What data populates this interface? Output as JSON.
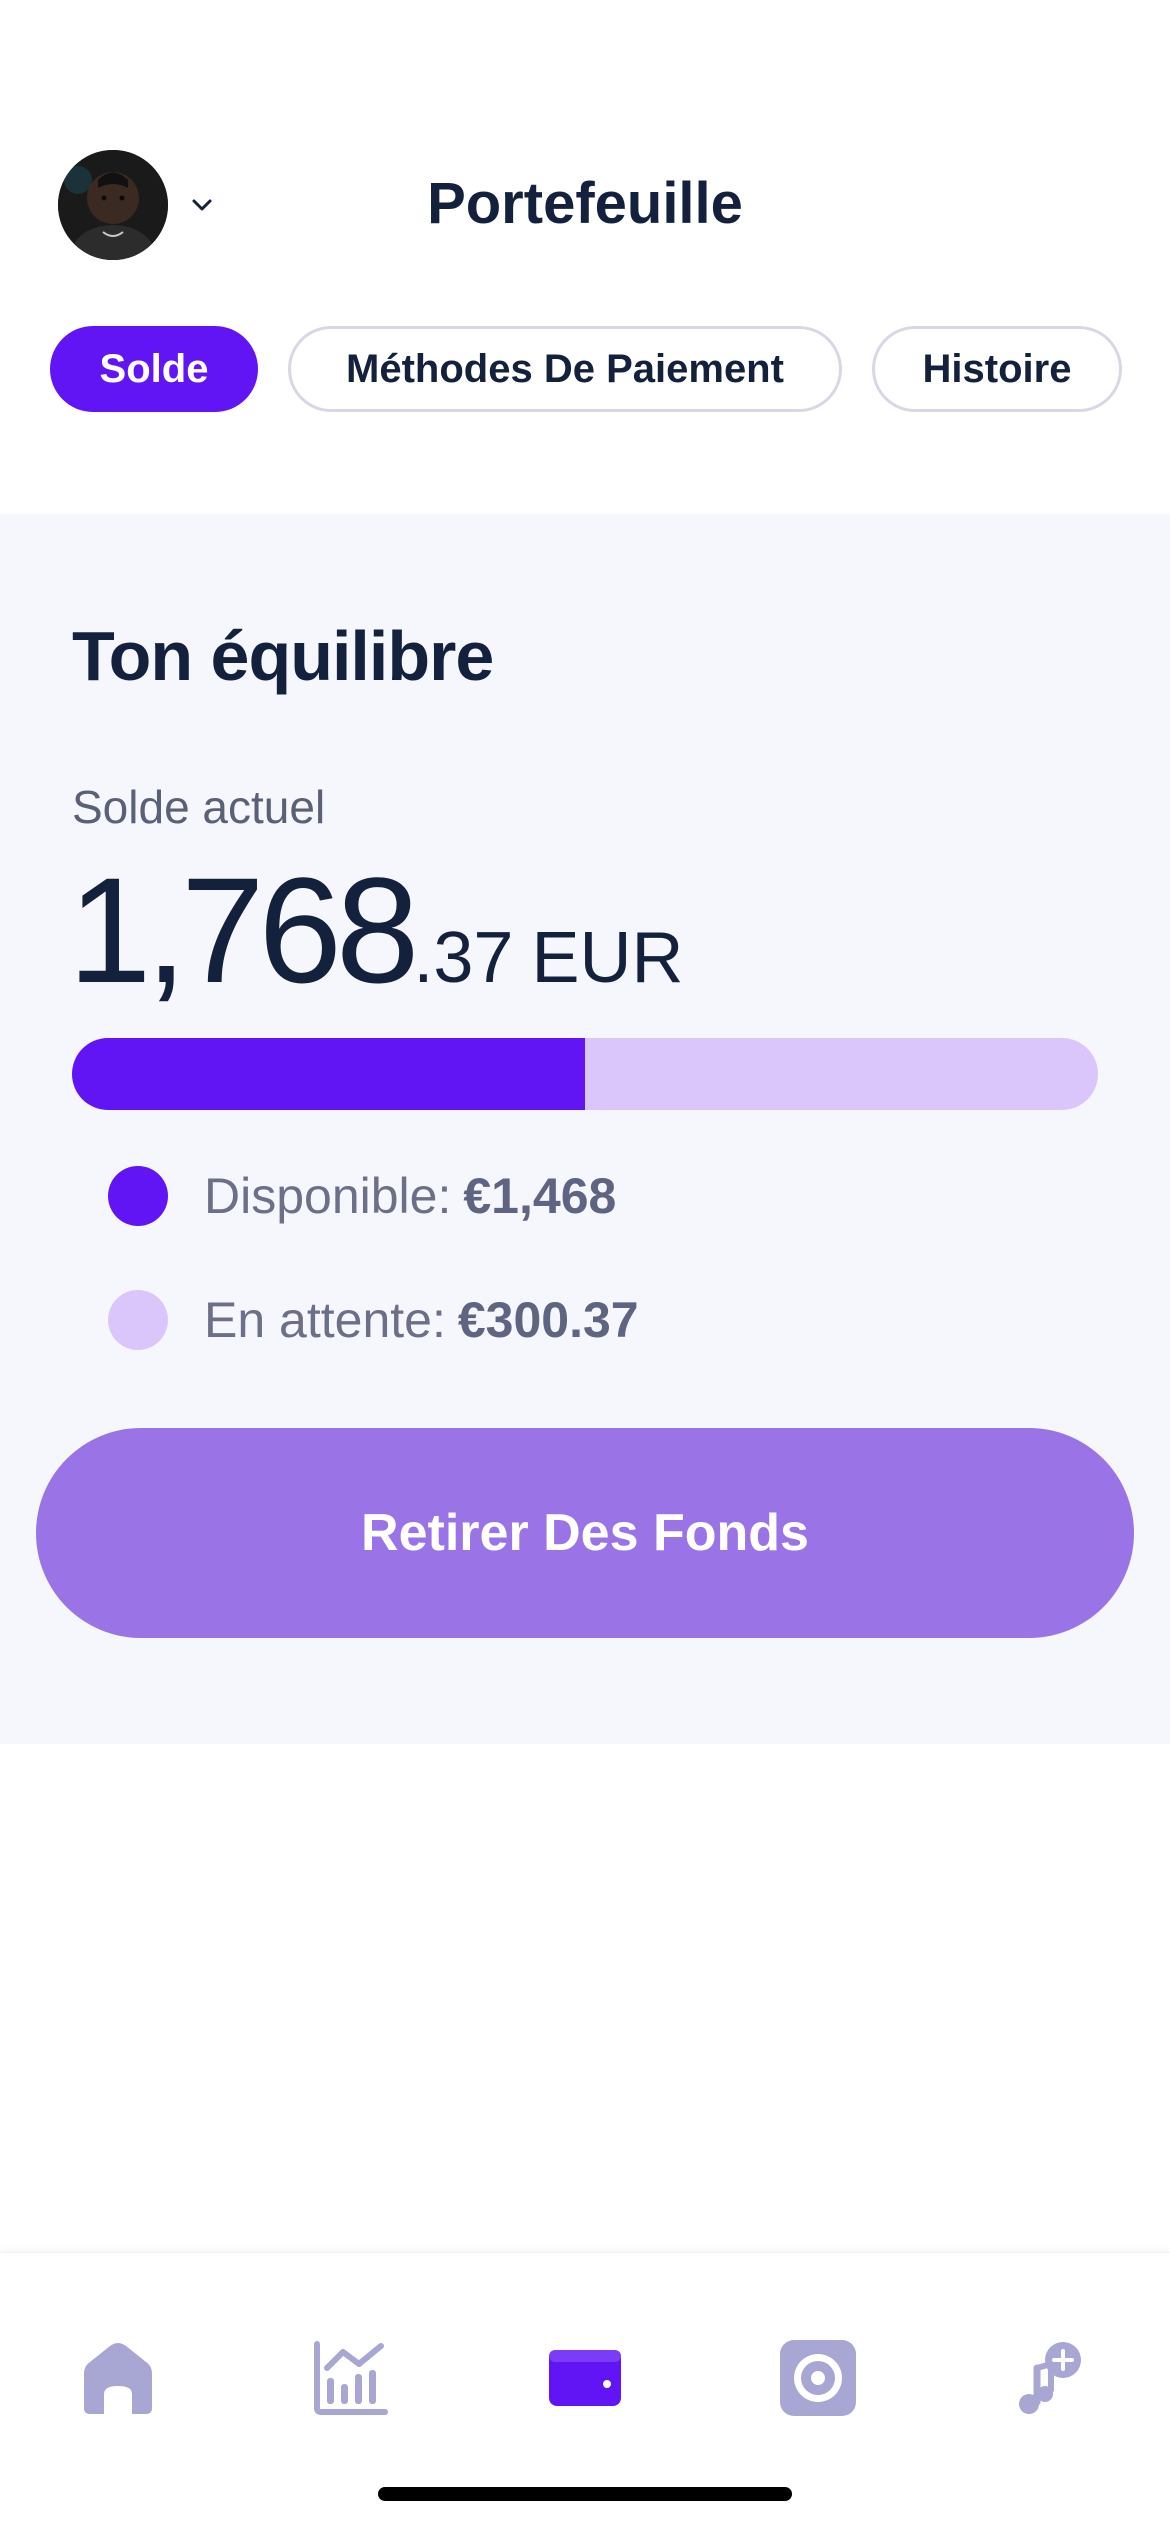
{
  "header": {
    "title": "Portefeuille",
    "avatar_icon": "avatar",
    "dropdown_icon": "chevron-down-icon"
  },
  "tabs": [
    {
      "label": "Solde",
      "active": true
    },
    {
      "label": "Méthodes De Paiement",
      "active": false
    },
    {
      "label": "Histoire",
      "active": false
    }
  ],
  "balance": {
    "heading": "Ton équilibre",
    "current_label": "Solde actuel",
    "amount_main": "1,768",
    "amount_cents": ".37",
    "currency": "EUR",
    "available_fraction": 0.5,
    "available_label": "Disponible:",
    "available_value": "€1,468",
    "pending_label": "En attente:",
    "pending_value": "€300.37",
    "withdraw_label": "Retirer Des Fonds"
  },
  "colors": {
    "accent": "#6115f5",
    "accent_light": "#dbc6fb",
    "button": "#9a74e6",
    "nav_inactive": "#a8a6d2"
  },
  "nav": [
    {
      "icon": "home-icon",
      "active": false
    },
    {
      "icon": "chart-icon",
      "active": false
    },
    {
      "icon": "wallet-icon",
      "active": true
    },
    {
      "icon": "vinyl-icon",
      "active": false
    },
    {
      "icon": "music-add-icon",
      "active": false
    }
  ]
}
